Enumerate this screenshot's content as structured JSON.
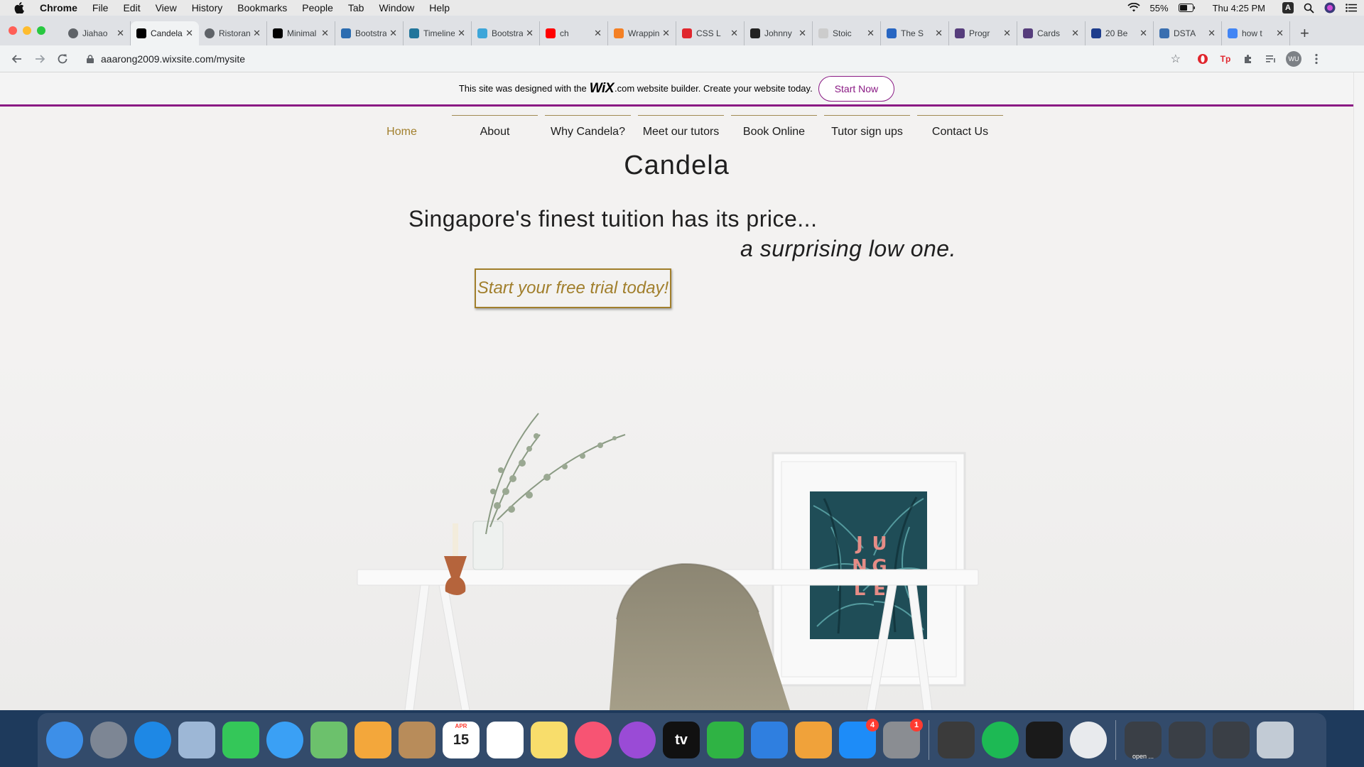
{
  "menubar": {
    "app_name": "Chrome",
    "items": [
      "File",
      "Edit",
      "View",
      "History",
      "Bookmarks",
      "People",
      "Tab",
      "Window",
      "Help"
    ],
    "battery": "55%",
    "clock": "Thu 4:25 PM",
    "input_source": "A"
  },
  "browser": {
    "tabs": [
      {
        "title": "Jiahao",
        "favicon": "globe-icon",
        "color": "#5f6368"
      },
      {
        "title": "Candela",
        "favicon": "wix-icon",
        "color": "#000000",
        "active": true
      },
      {
        "title": "Ristorante",
        "favicon": "globe-icon",
        "color": "#5f6368"
      },
      {
        "title": "Minimal",
        "favicon": "ch-icon",
        "color": "#000000"
      },
      {
        "title": "Bootstrap",
        "favicon": "bootstrap-icon",
        "color": "#2b6cb0"
      },
      {
        "title": "Timeline",
        "favicon": "wordpress-icon",
        "color": "#21759b"
      },
      {
        "title": "Bootstrap",
        "favicon": "bd-icon",
        "color": "#3ea6d9"
      },
      {
        "title": "ch",
        "favicon": "youtube-icon",
        "color": "#ff0000"
      },
      {
        "title": "Wrapping",
        "favicon": "stack-icon",
        "color": "#f48024"
      },
      {
        "title": "CSS L",
        "favicon": "opera-icon",
        "color": "#e0262d"
      },
      {
        "title": "Johnny",
        "favicon": "star-icon",
        "color": "#222222"
      },
      {
        "title": "Stoic",
        "favicon": "blank-icon",
        "color": "#cccccc"
      },
      {
        "title": "The S",
        "favicon": "w-icon",
        "color": "#2866c2"
      },
      {
        "title": "Progr",
        "favicon": "b-icon",
        "color": "#563d7c"
      },
      {
        "title": "Cards",
        "favicon": "b-icon",
        "color": "#563d7c"
      },
      {
        "title": "20 Be",
        "favicon": "h-icon",
        "color": "#1d3c8c"
      },
      {
        "title": "DSTA",
        "favicon": "dsta-icon",
        "color": "#3a6fb0"
      },
      {
        "title": "how t",
        "favicon": "google-icon",
        "color": "#4285f4"
      }
    ],
    "url": "aaarong2009.wixsite.com/mysite",
    "profile_initials": "WU"
  },
  "wix_banner": {
    "text_before": "This site was designed with the",
    "logo": "WiX",
    "text_after": ".com website builder. Create your website today.",
    "button": "Start Now"
  },
  "site": {
    "nav": [
      "Home",
      "About",
      "Why Candela?",
      "Meet our tutors",
      "Book Online",
      "Tutor sign ups",
      "Contact Us"
    ],
    "title": "Candela",
    "tagline_line1": "Singapore's finest tuition has its price...",
    "tagline_line2": "a surprising low one.",
    "cta": "Start your free trial today!",
    "poster_letters": [
      "J",
      "U",
      "N",
      "G",
      "L",
      "E"
    ],
    "accent_color": "#a17f2c",
    "brand_color": "#8a1a84"
  },
  "dock": {
    "apps": [
      {
        "name": "finder-icon",
        "color": "#3d8fe8"
      },
      {
        "name": "launchpad-icon",
        "color": "#7d8694"
      },
      {
        "name": "safari-icon",
        "color": "#1e88e5"
      },
      {
        "name": "mail-icon",
        "color": "#9db7d6"
      },
      {
        "name": "facetime-icon",
        "color": "#34c759"
      },
      {
        "name": "messages-icon",
        "color": "#3aa0f5"
      },
      {
        "name": "maps-icon",
        "color": "#6cc16c"
      },
      {
        "name": "photos-icon",
        "color": "#f3a73b"
      },
      {
        "name": "contacts-icon",
        "color": "#b88c5a"
      },
      {
        "name": "calendar-icon",
        "color": "#ffffff",
        "label": "15",
        "month": "APR"
      },
      {
        "name": "reminders-icon",
        "color": "#ffffff"
      },
      {
        "name": "notes-icon",
        "color": "#f8dd6b"
      },
      {
        "name": "music-icon",
        "color": "#f75473"
      },
      {
        "name": "podcasts-icon",
        "color": "#9a4bd6"
      },
      {
        "name": "appletv-icon",
        "color": "#111111",
        "label": "tv"
      },
      {
        "name": "numbers-icon",
        "color": "#2fb344"
      },
      {
        "name": "keynote-icon",
        "color": "#2f7fe0"
      },
      {
        "name": "pages-icon",
        "color": "#f0a23a"
      },
      {
        "name": "appstore-icon",
        "color": "#1d8cf8",
        "badge": "4"
      },
      {
        "name": "system-preferences-icon",
        "color": "#8a8d92",
        "badge": "1"
      },
      {
        "name": "sublime-text-icon",
        "color": "#3b3b3b"
      },
      {
        "name": "spotify-icon",
        "color": "#1db954"
      },
      {
        "name": "terminal-icon",
        "color": "#1a1a1a"
      },
      {
        "name": "chrome-icon",
        "color": "#e8eaed"
      }
    ],
    "recent": [
      {
        "name": "window-thumbnail-icon",
        "label": "open ..."
      },
      {
        "name": "window-thumbnail-icon",
        "label": ""
      },
      {
        "name": "downloads-stack-icon",
        "label": ""
      },
      {
        "name": "trash-icon",
        "label": ""
      }
    ]
  }
}
